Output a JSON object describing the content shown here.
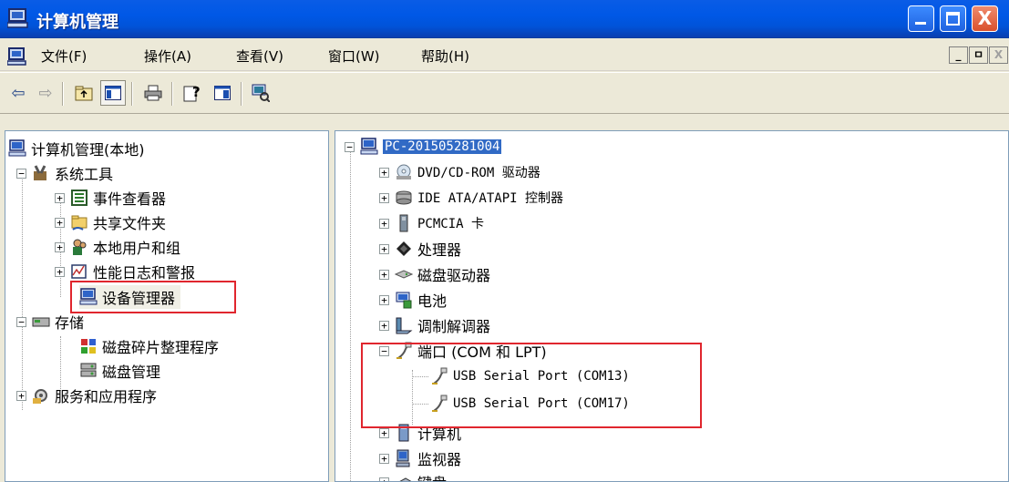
{
  "window": {
    "title": "计算机管理",
    "close_glyph": "X"
  },
  "menubar": {
    "items": [
      {
        "label": "文件(F)"
      },
      {
        "label": "操作(A)"
      },
      {
        "label": "查看(V)"
      },
      {
        "label": "窗口(W)"
      },
      {
        "label": "帮助(H)"
      }
    ],
    "mdi_buttons": [
      "_",
      "ㅁ",
      "X"
    ]
  },
  "toolbar": {
    "icons": [
      "back-icon",
      "forward-icon",
      "up-folder-icon",
      "show-hide-tree-icon",
      "print-icon",
      "help-icon",
      "properties-icon",
      "scan-hardware-icon"
    ]
  },
  "left_tree": {
    "root": "计算机管理(本地)",
    "system_tools": "系统工具",
    "system_tools_children": [
      "事件查看器",
      "共享文件夹",
      "本地用户和组",
      "性能日志和警报",
      "设备管理器"
    ],
    "storage": "存储",
    "storage_children": [
      "磁盘碎片整理程序",
      "磁盘管理"
    ],
    "services": "服务和应用程序"
  },
  "right_tree": {
    "root": "PC-201505281004",
    "items": [
      {
        "label": "DVD/CD-ROM 驱动器",
        "icon": "disc-drive-icon"
      },
      {
        "label": "IDE ATA/ATAPI 控制器",
        "icon": "ide-controller-icon"
      },
      {
        "label": "PCMCIA 卡",
        "icon": "pcmcia-icon"
      },
      {
        "label": "处理器",
        "icon": "processor-icon"
      },
      {
        "label": "磁盘驱动器",
        "icon": "disk-drive-icon"
      },
      {
        "label": "电池",
        "icon": "battery-icon"
      },
      {
        "label": "调制解调器",
        "icon": "modem-icon"
      },
      {
        "label": "端口 (COM 和 LPT)",
        "icon": "port-icon"
      },
      {
        "label": "USB Serial Port (COM13)",
        "icon": "port-icon"
      },
      {
        "label": "USB Serial Port (COM17)",
        "icon": "port-icon"
      },
      {
        "label": "计算机",
        "icon": "computer-icon"
      },
      {
        "label": "监视器",
        "icon": "monitor-icon"
      },
      {
        "label": "键盘",
        "icon": "keyboard-icon"
      }
    ]
  },
  "colors": {
    "titlebar": "#0058e6",
    "selection": "#316ac5",
    "highlight_box": "#e0262e"
  }
}
